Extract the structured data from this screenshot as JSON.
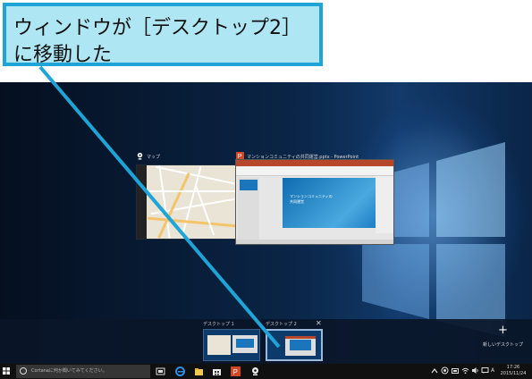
{
  "callout": {
    "line1": "ウィンドウが［デスクトップ2］",
    "line2": "に移動した"
  },
  "task_view": {
    "windows": [
      {
        "title": "マップ",
        "icon": "maps-icon"
      },
      {
        "title": "マンションコミュニティの共同運営.pptx - PowerPoint",
        "icon": "powerpoint-icon",
        "slide_text_1": "マンションコミュニティの",
        "slide_text_2": "共同運営"
      }
    ],
    "desktops": [
      {
        "label": "デスクトップ 1",
        "active": false
      },
      {
        "label": "デスクトップ 2",
        "active": true
      }
    ],
    "close_symbol": "✕",
    "new_desktop_plus": "+",
    "new_desktop_label": "新しいデスクトップ"
  },
  "taskbar": {
    "search_placeholder": "Cortanaに何か聞いてみてください。",
    "clock_time": "17:26",
    "clock_date": "2015/11/24",
    "ime_label": "A",
    "colors": {
      "bar": "#101010",
      "search": "#353535"
    }
  }
}
